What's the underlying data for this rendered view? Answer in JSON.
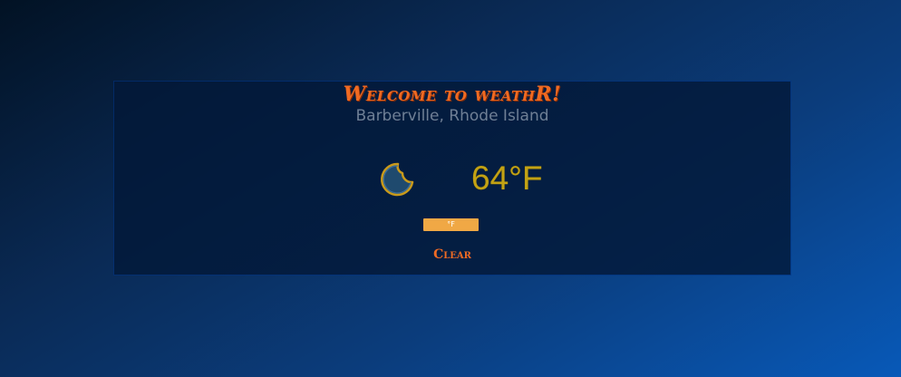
{
  "app": {
    "title": "Welcome to weathR!",
    "location": "Barberville, Rhode Island"
  },
  "weather": {
    "icon": "moon-icon",
    "temperature": "64°F"
  },
  "controls": {
    "unit_toggle_label": "°F",
    "clear_label": "Clear"
  },
  "colors": {
    "title": "#f06a22",
    "location": "#6f7f95",
    "temperature": "#c3a214",
    "unit_button": "#f0a845",
    "clear": "#ee6a24",
    "panel": "#031838",
    "moon_fill": "#1f4a6e",
    "moon_outline": "#c99a1b"
  }
}
